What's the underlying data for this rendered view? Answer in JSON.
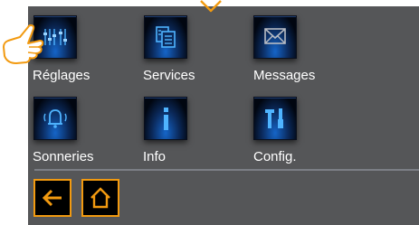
{
  "menu": {
    "items": [
      {
        "label": "Réglages",
        "icon": "sliders-icon"
      },
      {
        "label": "Services",
        "icon": "documents-icon"
      },
      {
        "label": "Messages",
        "icon": "envelope-icon"
      },
      {
        "label": "Sonneries",
        "icon": "bell-icon"
      },
      {
        "label": "Info",
        "icon": "info-icon"
      },
      {
        "label": "Config.",
        "icon": "tools-icon"
      }
    ]
  },
  "nav": {
    "back_icon": "back-arrow-icon",
    "home_icon": "home-icon"
  },
  "colors": {
    "screen_bg": "#555658",
    "accent": "#f29a10",
    "icon_blue": "#4fb4ff",
    "label_text": "#ffffff"
  }
}
